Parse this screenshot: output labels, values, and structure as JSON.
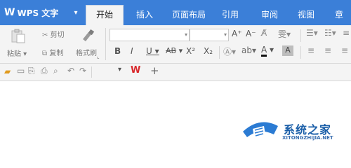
{
  "app": {
    "menu_label": "WPS 文字",
    "logo_mark": "W"
  },
  "tabs": [
    {
      "label": "开始",
      "active": true
    },
    {
      "label": "插入"
    },
    {
      "label": "页面布局"
    },
    {
      "label": "引用"
    },
    {
      "label": "审阅"
    },
    {
      "label": "视图"
    },
    {
      "label": "章"
    }
  ],
  "clipboard": {
    "paste_label": "粘贴",
    "cut_label": "剪切",
    "copy_label": "复制",
    "format_painter_label": "格式刷"
  },
  "font": {
    "bold": "B",
    "italic": "I",
    "underline": "U",
    "strikethrough": "AB",
    "superscript": "X²",
    "subscript": "X₂",
    "grow": "A⁺",
    "shrink": "A⁻",
    "font_color": "A"
  },
  "quick_access": {
    "separator_plus": "+"
  },
  "watermark": {
    "title": "系统之家",
    "url": "XITONGZHIJIA.NET"
  },
  "colors": {
    "title_bar": "#3b7fd8",
    "ribbon": "#f4f4f4",
    "wps_red": "#d9292c"
  }
}
